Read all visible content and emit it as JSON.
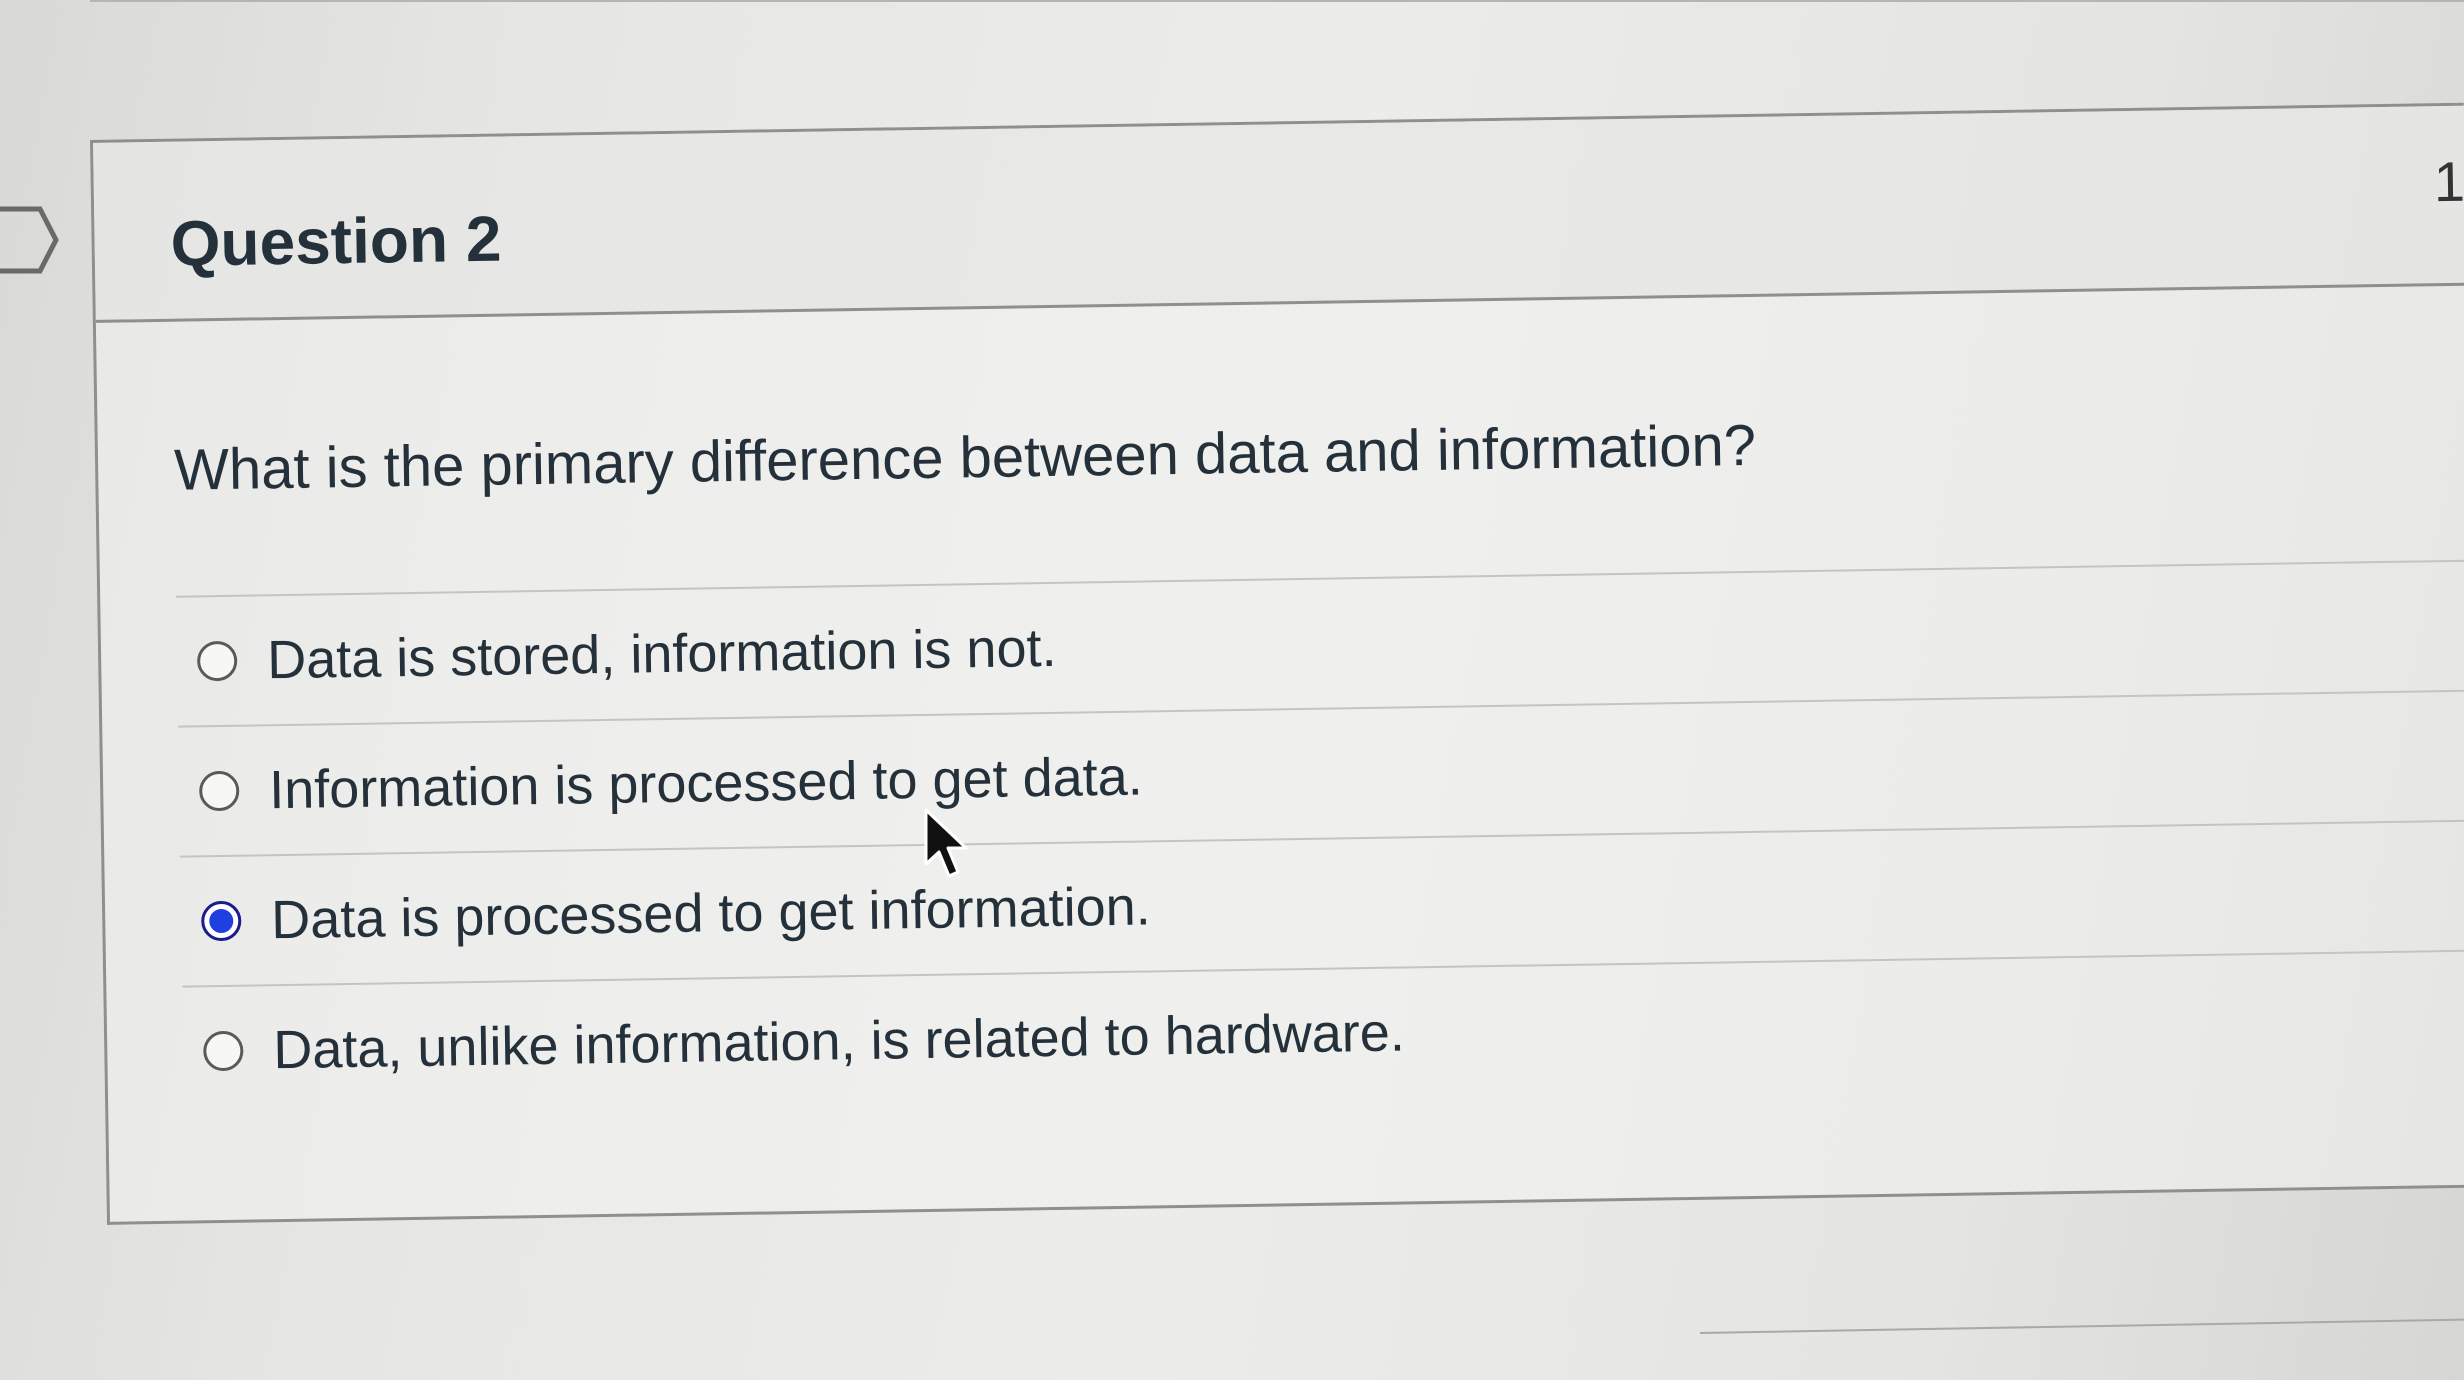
{
  "question": {
    "title": "Question 2",
    "points_partial": "1",
    "text": "What is the primary difference between data and information?",
    "answers": [
      {
        "label": "Data is stored, information is not.",
        "selected": false
      },
      {
        "label": "Information is processed to get data.",
        "selected": false
      },
      {
        "label": "Data is processed to get information.",
        "selected": true
      },
      {
        "label": "Data, unlike information, is related to hardware.",
        "selected": false
      }
    ]
  },
  "colors": {
    "selected_radio": "#1f3fe0",
    "text": "#25313a"
  },
  "icons": {
    "flag": "question-flag-icon",
    "cursor": "mouse-pointer-icon"
  }
}
